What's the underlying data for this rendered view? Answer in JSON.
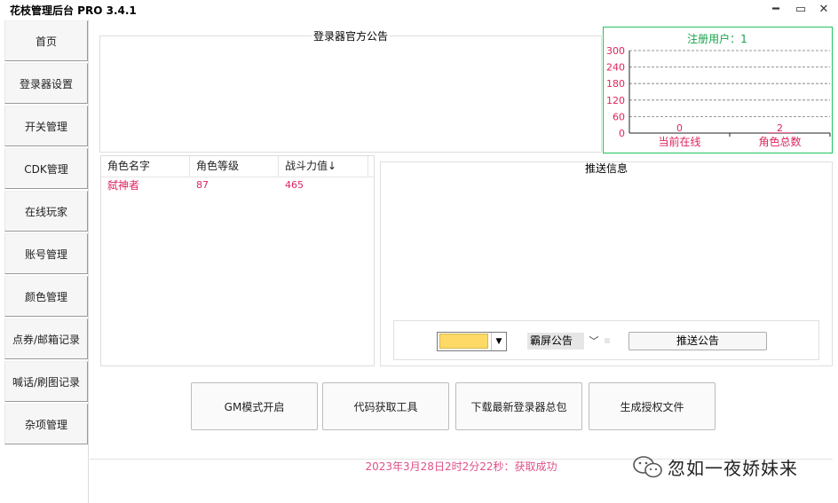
{
  "window": {
    "title": "花枝管理后台 PRO 3.4.1",
    "controls": {
      "minimize": "━",
      "maximize": "▭",
      "close": "✕"
    }
  },
  "sidebar": {
    "items": [
      {
        "label": "首页"
      },
      {
        "label": "登录器设置"
      },
      {
        "label": "开关管理"
      },
      {
        "label": "CDK管理"
      },
      {
        "label": "在线玩家"
      },
      {
        "label": "账号管理"
      },
      {
        "label": "颜色管理"
      },
      {
        "label": "点券/邮箱记录"
      },
      {
        "label": "喊话/刷图记录"
      },
      {
        "label": "杂项管理"
      }
    ]
  },
  "announcement": {
    "title": "登录器官方公告"
  },
  "chart_data": {
    "type": "bar",
    "title": "注册用户：1",
    "categories": [
      "当前在线",
      "角色总数"
    ],
    "values": [
      0,
      2
    ],
    "ylim": [
      0,
      300
    ],
    "yticks": [
      0,
      60,
      120,
      180,
      240,
      300
    ],
    "grid": true,
    "colors": {
      "border": "#22c55e",
      "title": "#16a34a",
      "labels": "#e0245e"
    }
  },
  "table": {
    "columns": [
      "角色名字",
      "角色等级",
      "战斗力值↓"
    ],
    "rows": [
      [
        "弑神者",
        "87",
        "465"
      ]
    ]
  },
  "push": {
    "title": "推送信息",
    "color_value": "#ffd966",
    "type_value": "霸屏公告",
    "button_label": "推送公告"
  },
  "actions": [
    {
      "label": "GM模式开启"
    },
    {
      "label": "代码获取工具"
    },
    {
      "label": "下载最新登录器总包"
    },
    {
      "label": "生成授权文件"
    }
  ],
  "status": {
    "text": "2023年3月28日2时2分22秒：获取成功"
  },
  "watermark": {
    "text": "忽如一夜娇妹来"
  }
}
